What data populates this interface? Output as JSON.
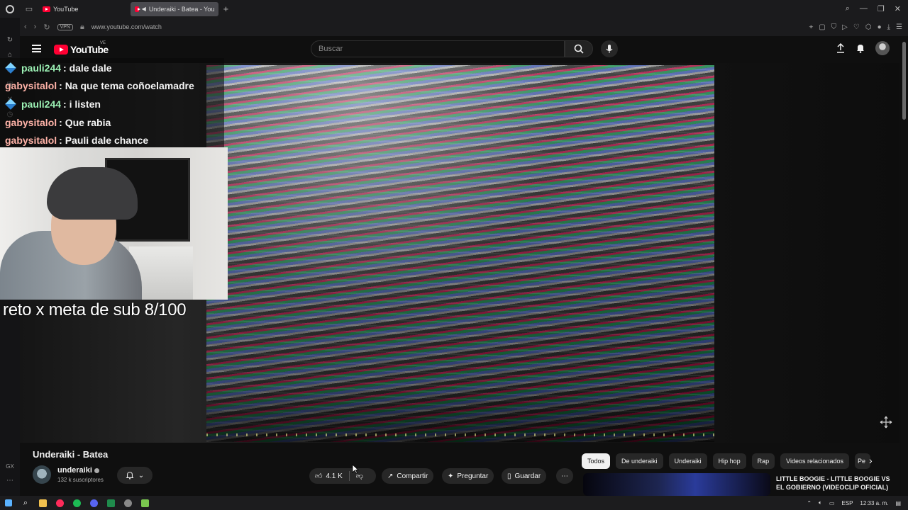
{
  "browser": {
    "tabs": [
      {
        "label": "YouTube"
      },
      {
        "label": "Underaiki - Batea - You"
      }
    ],
    "vpn_label": "VPN",
    "url": "www.youtube.com/watch"
  },
  "youtube": {
    "logo_text": "YouTube",
    "country_code": "VE",
    "search_placeholder": "Buscar"
  },
  "chat": [
    {
      "user": "pauli244",
      "message": ": dale dale",
      "color": "#9cf2b5"
    },
    {
      "user": "gabysitalol",
      "message": ": Na que tema coñoelamadre",
      "color": "#ffb3a8"
    },
    {
      "user": "pauli244",
      "message": ": i listen",
      "color": "#9cf2b5"
    },
    {
      "user": "gabysitalol",
      "message": ": Que rabia",
      "color": "#ffb3a8"
    },
    {
      "user": "gabysitalol",
      "message": ": Pauli dale chance",
      "color": "#ffb3a8"
    }
  ],
  "stream_overlay_text": "reto x meta de sub 8/100",
  "video": {
    "title": "Underaiki - Batea",
    "channel": "underaiki",
    "subscribers": "132 k suscriptores",
    "likes": "4.1 K",
    "share_label": "Compartir",
    "ask_label": "Preguntar",
    "save_label": "Guardar"
  },
  "chips": [
    "Todos",
    "De underaiki",
    "Underaiki",
    "Hip hop",
    "Rap",
    "Videos relacionados",
    "Pe"
  ],
  "recommended": {
    "title": "LITTLE BOOGIE - LITTLE BOOGIE VS EL GOBIERNO (VIDEOCLIP OFICIAL)"
  },
  "taskbar": {
    "language": "ESP",
    "time": "12:33 a. m."
  },
  "sidebar_label": "GX",
  "colors": {
    "accent": "#ff0033",
    "background": "#0f0f0f"
  }
}
